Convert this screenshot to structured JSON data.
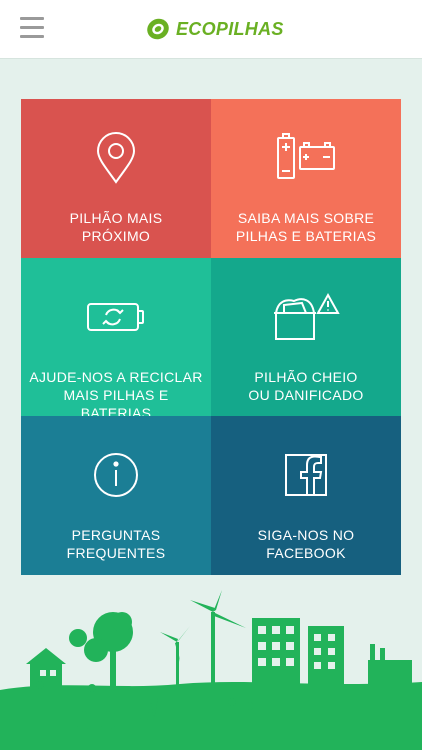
{
  "header": {
    "brand": "ECOPILHAS",
    "menu_icon": "hamburger-icon",
    "logo_icon": "battery-leaf-logo"
  },
  "tiles": [
    {
      "line1": "PILHÃO MAIS",
      "line2": "PRÓXIMO",
      "icon": "location-pin-icon",
      "color": "#d9534f"
    },
    {
      "line1": "SAIBA MAIS SOBRE",
      "line2": "PILHAS E BATERIAS",
      "icon": "batteries-icon",
      "color": "#f47159"
    },
    {
      "line1": "AJUDE-NOS A RECICLAR",
      "line2": "MAIS PILHAS E BATERIAS",
      "icon": "recycle-battery-icon",
      "color": "#1fbf98"
    },
    {
      "line1": "PILHÃO CHEIO",
      "line2": "OU DANIFICADO",
      "icon": "full-bin-warning-icon",
      "color": "#14a88c"
    },
    {
      "line1": "PERGUNTAS",
      "line2": "FREQUENTES",
      "icon": "info-icon",
      "color": "#1b7e95"
    },
    {
      "line1": "SIGA-NOS NO",
      "line2": "FACEBOOK",
      "icon": "facebook-icon",
      "color": "#16607f"
    }
  ],
  "colors": {
    "brand_green": "#6ab023",
    "scene_green": "#22b35a",
    "background": "#e4f1ec"
  },
  "footer": {
    "illustration": "green-city-illustration"
  }
}
